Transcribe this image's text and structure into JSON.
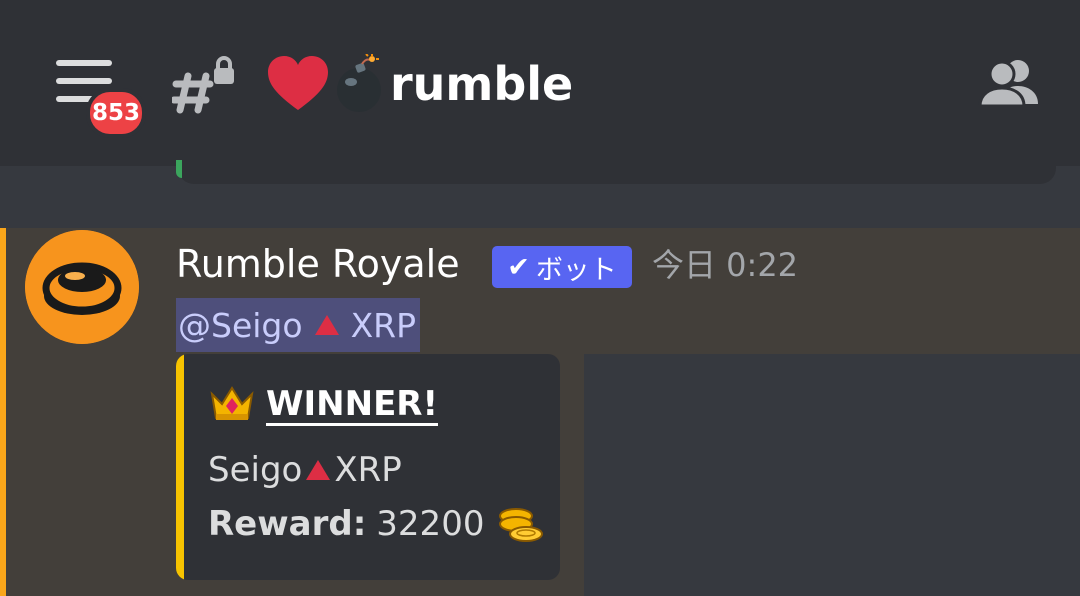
{
  "header": {
    "menu_badge": "853",
    "channel_name": "rumble",
    "icons": [
      "menu-icon",
      "locked-hash-icon",
      "heart-emoji",
      "bomb-emoji",
      "members-icon"
    ]
  },
  "message": {
    "username": "Rumble Royale",
    "bot_tag": "ボット",
    "timestamp": "今日 0:22",
    "mention": {
      "prefix": "@Seigo",
      "suffix": "XRP"
    },
    "embed": {
      "title": "WINNER!",
      "winner_name": "Seigo",
      "winner_suffix": "XRP",
      "reward_label": "Reward:",
      "reward_value": "32200",
      "accent_color": "#f7c300"
    }
  },
  "colors": {
    "header_bg": "#2f3136",
    "chat_bg": "#36393f",
    "highlight_bg": "#433f3a",
    "highlight_mark": "#faa61a",
    "mention_bg": "#4e4f7b",
    "bot_tag": "#5865f2",
    "badge": "#ed4245"
  }
}
